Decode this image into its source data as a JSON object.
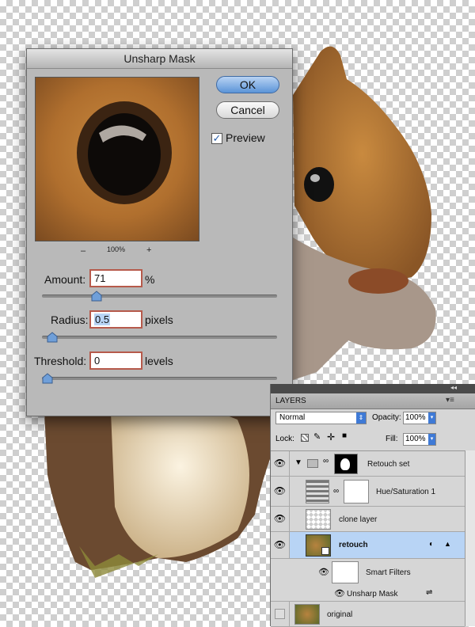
{
  "dialog": {
    "title": "Unsharp Mask",
    "ok_label": "OK",
    "cancel_label": "Cancel",
    "preview_label": "Preview",
    "preview_checked": true,
    "zoom_minus": "–",
    "zoom_level": "100%",
    "zoom_plus": "+",
    "amount": {
      "label": "Amount:",
      "value": "71",
      "unit": "%",
      "slider_fraction": 0.22
    },
    "radius": {
      "label": "Radius:",
      "value": "0.5",
      "unit": "pixels",
      "slider_fraction": 0.02
    },
    "threshold": {
      "label": "Threshold:",
      "value": "0",
      "unit": "levels",
      "slider_fraction": 0.0
    }
  },
  "layers_panel": {
    "tab_label": "LAYERS",
    "blend_mode": "Normal",
    "opacity_label": "Opacity:",
    "opacity_value": "100%",
    "lock_label": "Lock:",
    "fill_label": "Fill:",
    "fill_value": "100%",
    "rows": [
      {
        "name": "Retouch set"
      },
      {
        "name": "Hue/Saturation 1"
      },
      {
        "name": "clone layer"
      },
      {
        "name": "retouch",
        "selected": true
      },
      {
        "name": "Smart Filters"
      },
      {
        "name": "Unsharp Mask"
      },
      {
        "name": "original"
      }
    ]
  },
  "colors": {
    "selection": "#b8d4f5",
    "field_border": "#b65a4b",
    "default_button": "#5b94d8"
  }
}
